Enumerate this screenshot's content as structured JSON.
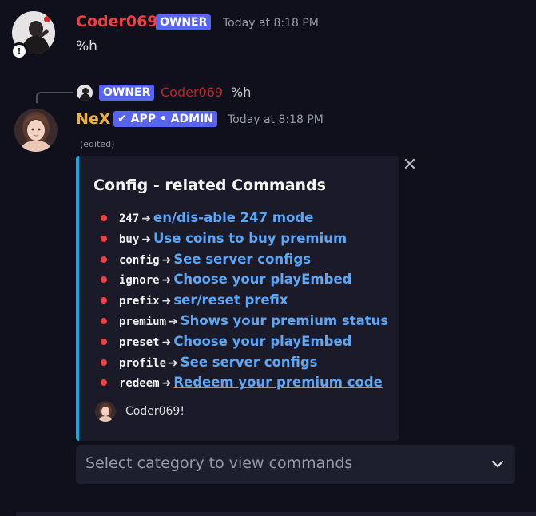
{
  "message1": {
    "username": "Coder069",
    "badge": "OWNER",
    "timestamp": "Today at 8:18 PM",
    "content": "%h",
    "status_glyph": "!",
    "colors": {
      "username": "#f23f43",
      "badge": "#5865f2"
    }
  },
  "reply": {
    "badge": "OWNER",
    "username": "Coder069",
    "content": "%h"
  },
  "message2": {
    "username": "NeX",
    "badge_check": "✔",
    "badge": "APP • ADMIN",
    "timestamp": "Today at 8:18 PM",
    "edited": "(edited)",
    "colors": {
      "username": "#f0b232"
    }
  },
  "embed": {
    "title": "Config - related Commands",
    "accent_color": "#00b0f4",
    "arrow": "➜",
    "commands": [
      {
        "cmd": "247",
        "desc": "en/dis-able 247 mode",
        "link": false
      },
      {
        "cmd": "buy",
        "desc": "Use coins to buy premium",
        "link": false
      },
      {
        "cmd": "config",
        "desc": "See server configs",
        "link": false
      },
      {
        "cmd": "ignore",
        "desc": "Choose your playEmbed",
        "link": false
      },
      {
        "cmd": "prefix",
        "desc": "ser/reset prefix",
        "link": false
      },
      {
        "cmd": "premium",
        "desc": "Shows your premium status",
        "link": false
      },
      {
        "cmd": "preset",
        "desc": "Choose your playEmbed",
        "link": false
      },
      {
        "cmd": "profile",
        "desc": "See server configs",
        "link": false
      },
      {
        "cmd": "redeem",
        "desc": "Redeem your premium code",
        "link": true
      }
    ],
    "footer": "Coder069!",
    "close_glyph": "✕"
  },
  "select": {
    "placeholder": "Select category to view commands",
    "icon": "chevron-down-icon"
  }
}
